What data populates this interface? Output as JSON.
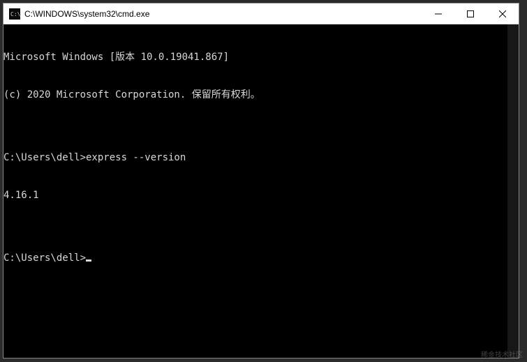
{
  "window": {
    "title": "C:\\WINDOWS\\system32\\cmd.exe"
  },
  "terminal": {
    "lines": [
      "Microsoft Windows [版本 10.0.19041.867]",
      "(c) 2020 Microsoft Corporation. 保留所有权利。",
      "",
      "C:\\Users\\dell>express --version",
      "4.16.1",
      "",
      "C:\\Users\\dell>"
    ]
  },
  "watermark": "稀金技术社区"
}
